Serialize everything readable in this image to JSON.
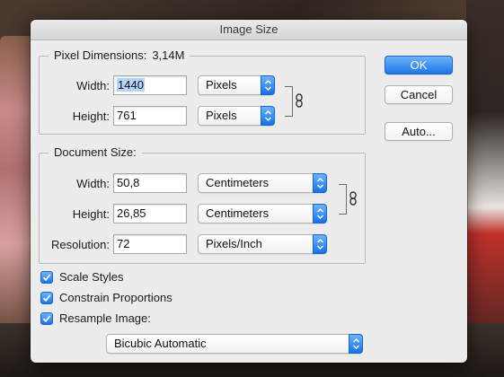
{
  "window": {
    "title": "Image Size"
  },
  "pixel_dimensions": {
    "legend": "Pixel Dimensions:",
    "size_value": "3,14M",
    "width": {
      "label": "Width:",
      "value": "1440",
      "unit": "Pixels"
    },
    "height": {
      "label": "Height:",
      "value": "761",
      "unit": "Pixels"
    }
  },
  "document_size": {
    "legend": "Document Size:",
    "width": {
      "label": "Width:",
      "value": "50,8",
      "unit": "Centimeters"
    },
    "height": {
      "label": "Height:",
      "value": "26,85",
      "unit": "Centimeters"
    },
    "resolution": {
      "label": "Resolution:",
      "value": "72",
      "unit": "Pixels/Inch"
    }
  },
  "buttons": {
    "ok": "OK",
    "cancel": "Cancel",
    "auto": "Auto..."
  },
  "options": {
    "scale_styles": {
      "label": "Scale Styles",
      "checked": true
    },
    "constrain_proportions": {
      "label": "Constrain Proportions",
      "checked": true
    },
    "resample_image": {
      "label": "Resample Image:",
      "checked": true
    }
  },
  "resample_method": "Bicubic Automatic",
  "colors": {
    "accent": "#1a77ea",
    "dialog_bg": "#ececec"
  },
  "icons": {
    "link": "chain-link-icon",
    "popup": "updown-chevron-icon",
    "check": "checkmark-icon"
  }
}
